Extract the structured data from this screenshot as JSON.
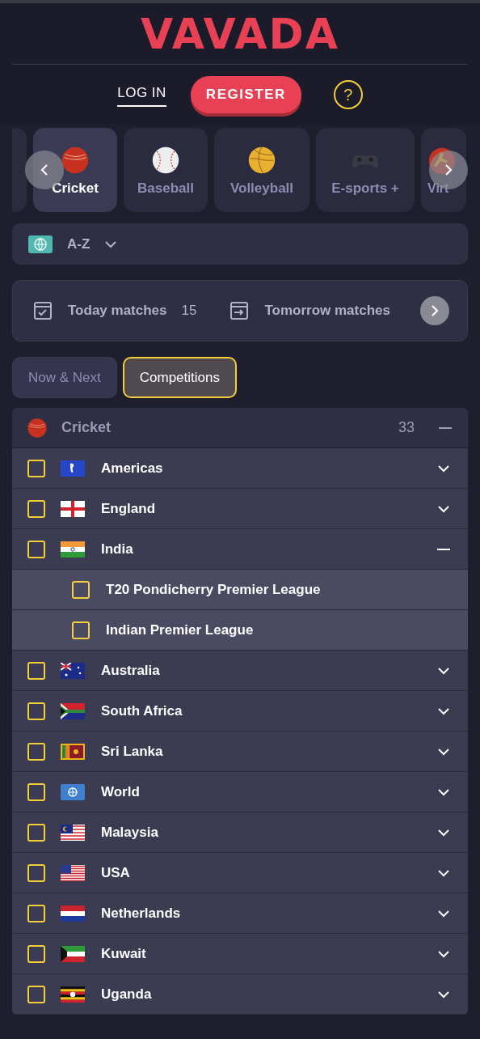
{
  "header": {
    "logo": "VAVADA",
    "login": "LOG IN",
    "register": "REGISTER",
    "help": "?"
  },
  "sports": [
    {
      "label": "Cricket",
      "selected": true
    },
    {
      "label": "Baseball",
      "selected": false
    },
    {
      "label": "Volleyball",
      "selected": false
    },
    {
      "label": "E-sports +",
      "selected": false
    },
    {
      "label": "Virt",
      "selected": false
    }
  ],
  "sort": {
    "label": "A-Z"
  },
  "matches": [
    {
      "label": "Today matches",
      "count": "15"
    },
    {
      "label": "Tomorrow matches"
    }
  ],
  "tabs": [
    {
      "label": "Now & Next",
      "selected": false
    },
    {
      "label": "Competitions",
      "selected": true
    }
  ],
  "sport_group": {
    "name": "Cricket",
    "count": "33",
    "expanded": true
  },
  "regions": [
    {
      "name": "Americas",
      "checked": false,
      "expanded": false
    },
    {
      "name": "England",
      "checked": false,
      "expanded": false
    },
    {
      "name": "India",
      "checked": false,
      "expanded": true,
      "children": [
        {
          "name": "T20 Pondicherry Premier League",
          "checked": false
        },
        {
          "name": "Indian Premier League",
          "checked": false
        }
      ]
    },
    {
      "name": "Australia",
      "checked": false,
      "expanded": false
    },
    {
      "name": "South Africa",
      "checked": false,
      "expanded": false
    },
    {
      "name": "Sri Lanka",
      "checked": false,
      "expanded": false
    },
    {
      "name": "World",
      "checked": false,
      "expanded": false
    },
    {
      "name": "Malaysia",
      "checked": false,
      "expanded": false
    },
    {
      "name": "USA",
      "checked": false,
      "expanded": false
    },
    {
      "name": "Netherlands",
      "checked": false,
      "expanded": false
    },
    {
      "name": "Kuwait",
      "checked": false,
      "expanded": false
    },
    {
      "name": "Uganda",
      "checked": false,
      "expanded": false
    }
  ]
}
